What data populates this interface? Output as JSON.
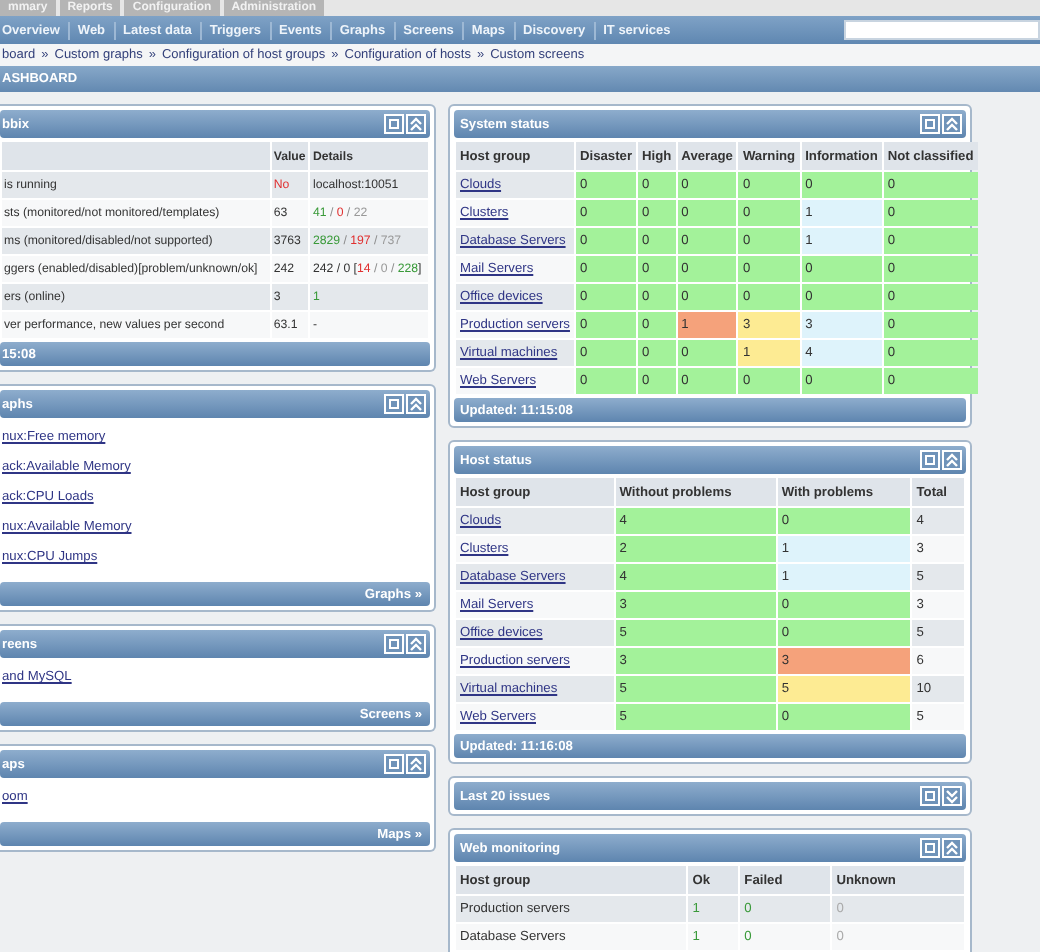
{
  "top_tabs": [
    "mmary",
    "Reports",
    "Configuration",
    "Administration"
  ],
  "nav": [
    "Overview",
    "Web",
    "Latest data",
    "Triggers",
    "Events",
    "Graphs",
    "Screens",
    "Maps",
    "Discovery",
    "IT services"
  ],
  "breadcrumbs": [
    "board",
    "Custom graphs",
    "Configuration of host groups",
    "Configuration of hosts",
    "Custom screens"
  ],
  "breadcrumb_separator": "»",
  "page_title": "ASHBOARD",
  "left": [
    {
      "title": "bbix",
      "collapsed": false,
      "kind": "table",
      "columns": [
        "",
        "Value",
        "Details"
      ],
      "rows": [
        [
          {
            "text": "is running"
          },
          {
            "parts": [
              {
                "text": "No",
                "color": "#e03030"
              }
            ]
          },
          {
            "text": "localhost:10051"
          }
        ],
        [
          {
            "text": "sts (monitored/not monitored/templates)"
          },
          {
            "text": "63"
          },
          {
            "parts": [
              {
                "text": "41",
                "color": "#3a9a3a"
              },
              {
                "text": " / ",
                "kind": "separator"
              },
              {
                "text": "0",
                "color": "#e03030"
              },
              {
                "text": " / ",
                "kind": "separator"
              },
              {
                "text": "22",
                "color": "#999999"
              }
            ]
          }
        ],
        [
          {
            "text": "ms (monitored/disabled/not supported)"
          },
          {
            "text": "3763"
          },
          {
            "parts": [
              {
                "text": "2829",
                "color": "#3a9a3a"
              },
              {
                "text": " / ",
                "kind": "separator"
              },
              {
                "text": "197",
                "color": "#e03030"
              },
              {
                "text": " / ",
                "kind": "separator"
              },
              {
                "text": "737",
                "color": "#999999"
              }
            ]
          }
        ],
        [
          {
            "text": "ggers (enabled/disabled)[problem/unknown/ok]"
          },
          {
            "text": "242"
          },
          {
            "parts": [
              {
                "text": "242 / 0  [",
                "kind": "plain"
              },
              {
                "text": "14",
                "color": "#e03030"
              },
              {
                "text": " / ",
                "kind": "separator"
              },
              {
                "text": "0",
                "color": "#999999"
              },
              {
                "text": " / ",
                "kind": "separator"
              },
              {
                "text": "228",
                "color": "#3a9a3a"
              },
              {
                "text": "]",
                "kind": "plain"
              }
            ]
          }
        ],
        [
          {
            "text": "ers (online)"
          },
          {
            "text": "3"
          },
          {
            "parts": [
              {
                "text": "1",
                "color": "#3a9a3a"
              }
            ]
          }
        ],
        [
          {
            "text": "ver performance, new values per second"
          },
          {
            "text": "63.1"
          },
          {
            "text": "-"
          }
        ]
      ],
      "footer": {
        "text": "15:08",
        "kind": "time"
      }
    },
    {
      "title": "aphs",
      "collapsed": false,
      "kind": "links",
      "links": [
        "nux:Free memory",
        "ack:Available Memory",
        "ack:CPU Loads",
        "nux:Available Memory",
        "nux:CPU Jumps"
      ],
      "footer": {
        "text": "Graphs »",
        "kind": "link"
      }
    },
    {
      "title": "reens",
      "collapsed": false,
      "kind": "links",
      "links": [
        "and MySQL"
      ],
      "footer": {
        "text": "Screens »",
        "kind": "link"
      }
    },
    {
      "title": "aps",
      "collapsed": false,
      "kind": "links",
      "links": [
        "oom"
      ],
      "footer": {
        "text": "Maps »",
        "kind": "link"
      }
    }
  ],
  "right": [
    {
      "title": "System status",
      "collapsed": false,
      "kind": "table",
      "columns": [
        "Host group",
        "Disaster",
        "High",
        "Average",
        "Warning",
        "Information",
        "Not classified"
      ],
      "rows": [
        [
          {
            "text": "Clouds",
            "link": true
          },
          {
            "text": "0",
            "color": "#a3f29a"
          },
          {
            "text": "0",
            "color": "#a3f29a"
          },
          {
            "text": "0",
            "color": "#a3f29a"
          },
          {
            "text": "0",
            "color": "#a3f29a"
          },
          {
            "text": "0",
            "color": "#a3f29a"
          },
          {
            "text": "0",
            "color": "#a3f29a"
          }
        ],
        [
          {
            "text": "Clusters",
            "link": true
          },
          {
            "text": "0",
            "color": "#a3f29a"
          },
          {
            "text": "0",
            "color": "#a3f29a"
          },
          {
            "text": "0",
            "color": "#a3f29a"
          },
          {
            "text": "0",
            "color": "#a3f29a"
          },
          {
            "text": "1",
            "color": "#def3fb"
          },
          {
            "text": "0",
            "color": "#a3f29a"
          }
        ],
        [
          {
            "text": "Database Servers",
            "link": true
          },
          {
            "text": "0",
            "color": "#a3f29a"
          },
          {
            "text": "0",
            "color": "#a3f29a"
          },
          {
            "text": "0",
            "color": "#a3f29a"
          },
          {
            "text": "0",
            "color": "#a3f29a"
          },
          {
            "text": "1",
            "color": "#def3fb"
          },
          {
            "text": "0",
            "color": "#a3f29a"
          }
        ],
        [
          {
            "text": "Mail Servers",
            "link": true
          },
          {
            "text": "0",
            "color": "#a3f29a"
          },
          {
            "text": "0",
            "color": "#a3f29a"
          },
          {
            "text": "0",
            "color": "#a3f29a"
          },
          {
            "text": "0",
            "color": "#a3f29a"
          },
          {
            "text": "0",
            "color": "#a3f29a"
          },
          {
            "text": "0",
            "color": "#a3f29a"
          }
        ],
        [
          {
            "text": "Office devices",
            "link": true
          },
          {
            "text": "0",
            "color": "#a3f29a"
          },
          {
            "text": "0",
            "color": "#a3f29a"
          },
          {
            "text": "0",
            "color": "#a3f29a"
          },
          {
            "text": "0",
            "color": "#a3f29a"
          },
          {
            "text": "0",
            "color": "#a3f29a"
          },
          {
            "text": "0",
            "color": "#a3f29a"
          }
        ],
        [
          {
            "text": "Production servers",
            "link": true
          },
          {
            "text": "0",
            "color": "#a3f29a"
          },
          {
            "text": "0",
            "color": "#a3f29a"
          },
          {
            "text": "1",
            "color": "#f5a27b"
          },
          {
            "text": "3",
            "color": "#fdeb93"
          },
          {
            "text": "3",
            "color": "#def3fb"
          },
          {
            "text": "0",
            "color": "#a3f29a"
          }
        ],
        [
          {
            "text": "Virtual machines",
            "link": true
          },
          {
            "text": "0",
            "color": "#a3f29a"
          },
          {
            "text": "0",
            "color": "#a3f29a"
          },
          {
            "text": "0",
            "color": "#a3f29a"
          },
          {
            "text": "1",
            "color": "#fdeb93"
          },
          {
            "text": "4",
            "color": "#def3fb"
          },
          {
            "text": "0",
            "color": "#a3f29a"
          }
        ],
        [
          {
            "text": "Web Servers",
            "link": true
          },
          {
            "text": "0",
            "color": "#a3f29a"
          },
          {
            "text": "0",
            "color": "#a3f29a"
          },
          {
            "text": "0",
            "color": "#a3f29a"
          },
          {
            "text": "0",
            "color": "#a3f29a"
          },
          {
            "text": "0",
            "color": "#a3f29a"
          },
          {
            "text": "0",
            "color": "#a3f29a"
          }
        ]
      ],
      "footer": {
        "text": "Updated: 11:15:08",
        "kind": "time"
      }
    },
    {
      "title": "Host status",
      "collapsed": false,
      "kind": "table",
      "columns": [
        "Host group",
        "Without problems",
        "With problems",
        "Total"
      ],
      "rows": [
        [
          {
            "text": "Clouds",
            "link": true
          },
          {
            "text": "4",
            "color": "#a3f29a"
          },
          {
            "text": "0",
            "color": "#a3f29a"
          },
          {
            "text": "4"
          }
        ],
        [
          {
            "text": "Clusters",
            "link": true
          },
          {
            "text": "2",
            "color": "#a3f29a"
          },
          {
            "text": "1",
            "color": "#def3fb"
          },
          {
            "text": "3"
          }
        ],
        [
          {
            "text": "Database Servers",
            "link": true
          },
          {
            "text": "4",
            "color": "#a3f29a"
          },
          {
            "text": "1",
            "color": "#def3fb"
          },
          {
            "text": "5"
          }
        ],
        [
          {
            "text": "Mail Servers",
            "link": true
          },
          {
            "text": "3",
            "color": "#a3f29a"
          },
          {
            "text": "0",
            "color": "#a3f29a"
          },
          {
            "text": "3"
          }
        ],
        [
          {
            "text": "Office devices",
            "link": true
          },
          {
            "text": "5",
            "color": "#a3f29a"
          },
          {
            "text": "0",
            "color": "#a3f29a"
          },
          {
            "text": "5"
          }
        ],
        [
          {
            "text": "Production servers",
            "link": true
          },
          {
            "text": "3",
            "color": "#a3f29a"
          },
          {
            "text": "3",
            "color": "#f5a27b"
          },
          {
            "text": "6"
          }
        ],
        [
          {
            "text": "Virtual machines",
            "link": true
          },
          {
            "text": "5",
            "color": "#a3f29a"
          },
          {
            "text": "5",
            "color": "#fdeb93"
          },
          {
            "text": "10"
          }
        ],
        [
          {
            "text": "Web Servers",
            "link": true
          },
          {
            "text": "5",
            "color": "#a3f29a"
          },
          {
            "text": "0",
            "color": "#a3f29a"
          },
          {
            "text": "5"
          }
        ]
      ],
      "footer": {
        "text": "Updated: 11:16:08",
        "kind": "time"
      }
    },
    {
      "title": "Last 20 issues",
      "collapsed": true,
      "kind": "table"
    },
    {
      "title": "Web monitoring",
      "collapsed": false,
      "kind": "table",
      "columns": [
        "Host group",
        "Ok",
        "Failed",
        "Unknown"
      ],
      "rows": [
        [
          {
            "text": "Production servers"
          },
          {
            "parts": [
              {
                "text": "1",
                "color": "#3a9a3a"
              }
            ]
          },
          {
            "parts": [
              {
                "text": "0",
                "color": "#3a9a3a"
              }
            ]
          },
          {
            "parts": [
              {
                "text": "0",
                "color": "#aaaaaa"
              }
            ]
          }
        ],
        [
          {
            "text": "Database Servers"
          },
          {
            "parts": [
              {
                "text": "1",
                "color": "#3a9a3a"
              }
            ]
          },
          {
            "parts": [
              {
                "text": "0",
                "color": "#3a9a3a"
              }
            ]
          },
          {
            "parts": [
              {
                "text": "0",
                "color": "#aaaaaa"
              }
            ]
          }
        ]
      ]
    }
  ]
}
